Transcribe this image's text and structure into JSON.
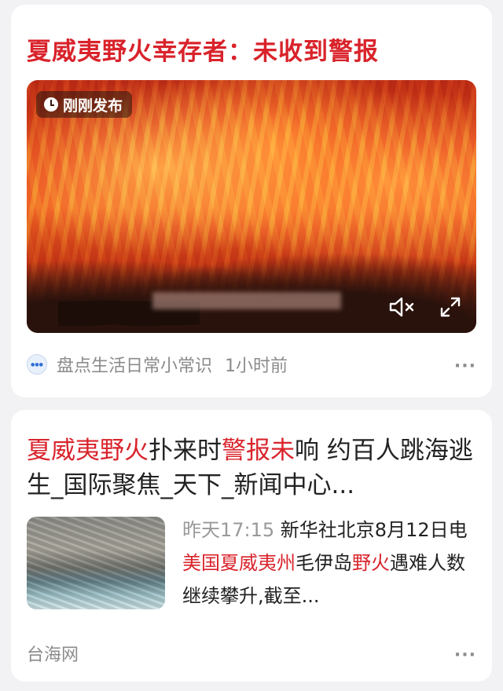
{
  "card1": {
    "title": "夏威夷野火幸存者：未收到警报",
    "video_badge": "刚刚发布",
    "source": "盘点生活日常小常识",
    "time": "1小时前",
    "more": "···"
  },
  "card2": {
    "title_parts": [
      "夏威夷野火",
      "扑来时",
      "警报未",
      "响 约百人跳海逃生_国际聚焦_天下_新闻中心..."
    ],
    "snippet_time": "昨天17:15",
    "snippet_parts": [
      " 新华社北京8月12日电 ",
      "美国夏威夷州",
      "毛伊岛",
      "野火",
      "遇难人数继续攀升,截至..."
    ],
    "source": "台海网",
    "more": "···"
  },
  "colors": {
    "accent": "#d9232b",
    "muted": "#8b8b8b",
    "background": "#f2f2f4"
  },
  "icons": [
    "clock-icon",
    "mute-icon",
    "fullscreen-icon",
    "more-icon"
  ]
}
